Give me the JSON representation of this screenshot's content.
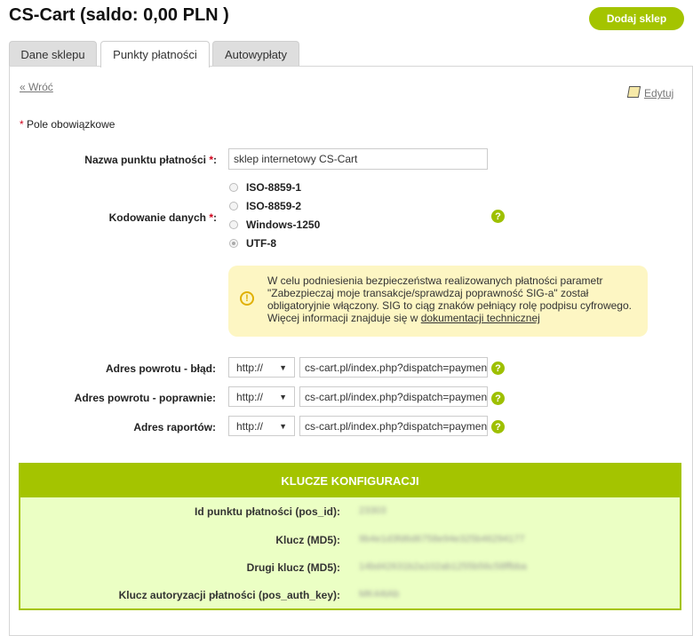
{
  "header": {
    "title": "CS-Cart (saldo: 0,00 PLN )",
    "add_shop_label": "Dodaj sklep"
  },
  "tabs": [
    {
      "label": "Dane sklepu"
    },
    {
      "label": "Punkty płatności"
    },
    {
      "label": "Autowypłaty"
    }
  ],
  "nav": {
    "back_label": "« Wróć",
    "edit_label": "Edytuj"
  },
  "form": {
    "required_note": "Pole obowiązkowe",
    "required_mark": "*",
    "pos_name": {
      "label": "Nazwa punktu płatności",
      "value": "sklep internetowy CS-Cart"
    },
    "encoding": {
      "label": "Kodowanie danych",
      "options": [
        "ISO-8859-1",
        "ISO-8859-2",
        "Windows-1250",
        "UTF-8"
      ],
      "selected": "UTF-8"
    },
    "notice": {
      "text": "W celu podniesienia bezpieczeństwa realizowanych płatności parametr \"Zabezpieczaj moje transakcje/sprawdzaj poprawność SIG-a\" został obligatoryjnie włączony. SIG to ciąg znaków pełniący rolę podpisu cyfrowego. Więcej informacji znajduje się w ",
      "link": "dokumentacji technicznej"
    },
    "return_error": {
      "label": "Adres powrotu - błąd:",
      "protocol": "http://",
      "value": "cs-cart.pl/index.php?dispatch=payment"
    },
    "return_ok": {
      "label": "Adres powrotu - poprawnie:",
      "protocol": "http://",
      "value": "cs-cart.pl/index.php?dispatch=payment"
    },
    "report": {
      "label": "Adres raportów:",
      "protocol": "http://",
      "value": "cs-cart.pl/index.php?dispatch=payment"
    },
    "help_glyph": "?"
  },
  "keys": {
    "title": "KLUCZE KONFIGURACJI",
    "rows": [
      {
        "label": "Id punktu płatności (pos_id):",
        "value": "23303"
      },
      {
        "label": "Klucz (MD5):",
        "value": "9b4e1d3fd6d6758e94e325b46294177"
      },
      {
        "label": "Drugi klucz (MD5):",
        "value": "14bd42631b2a102ab1255b56c58ffbba"
      },
      {
        "label": "Klucz autoryzacji płatności (pos_auth_key):",
        "value": "MK44tAb"
      }
    ]
  },
  "colors": {
    "accent": "#a4c400",
    "keys_bg": "#ebffc4",
    "notice_bg": "#fdf6c3",
    "required": "#d0021b"
  }
}
